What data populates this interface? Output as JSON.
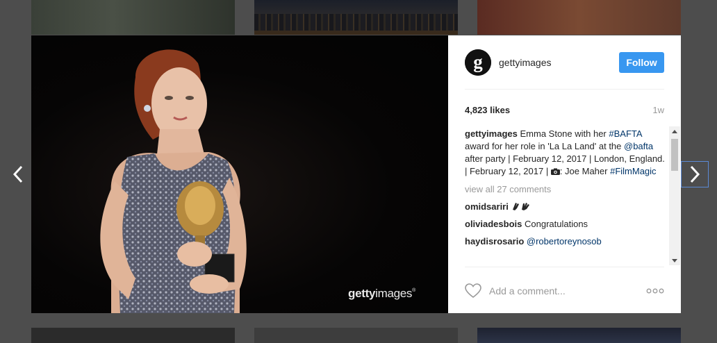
{
  "post": {
    "username": "gettyimages",
    "follow_label": "Follow",
    "likes": "4,823 likes",
    "time": "1w",
    "caption": {
      "user": "gettyimages",
      "t1": " Emma Stone with her ",
      "tag1": "#BAFTA",
      "t2": " award for her role in 'La La Land' at the ",
      "mention1": "@bafta",
      "t3": " after party | February 12, 2017 | London, England. | February 12, 2017 | ",
      "camera_icon": "camera-icon",
      "t4": ": Joe Maher ",
      "tag2": "#FilmMagic"
    },
    "view_all": "view all 27 comments",
    "comments": [
      {
        "user": "omidsariri",
        "text": "",
        "emoji": "clap-hands-emoji"
      },
      {
        "user": "oliviadesbois",
        "text": "Congratulations"
      },
      {
        "user": "haydisrosario",
        "mention": "@robertoreynosob"
      }
    ],
    "add_comment_placeholder": "Add a comment...",
    "watermark": {
      "bold": "getty",
      "rest": "images",
      "mark": "®"
    }
  },
  "colors": {
    "follow_bg": "#3897f0",
    "tag_color": "#003569",
    "overlay_bg": "#4d4d4d"
  },
  "icons": {
    "prev": "chevron-left-icon",
    "next": "chevron-right-icon",
    "heart": "heart-icon",
    "more": "more-options-icon",
    "avatar": "gettyimages-logo"
  }
}
